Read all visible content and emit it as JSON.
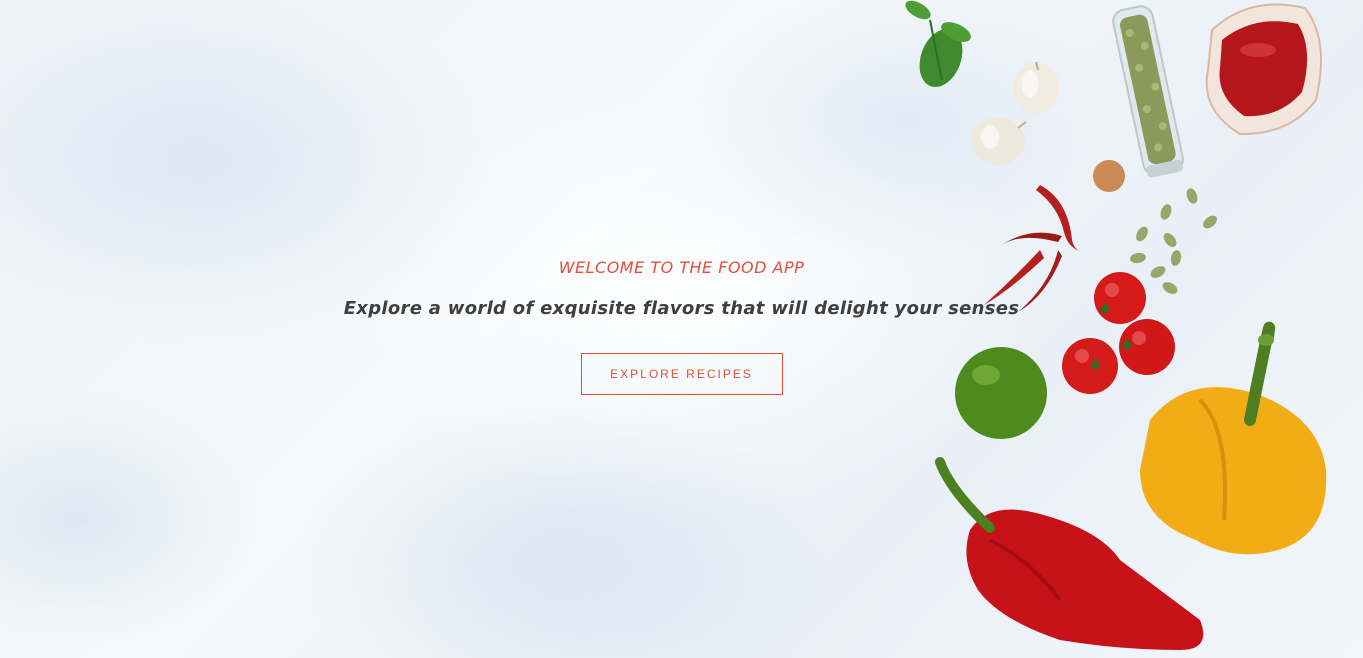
{
  "hero": {
    "welcome_text": "WELCOME TO THE FOOD APP",
    "tagline": "Explore a world of exquisite flavors that will delight your senses",
    "cta_label": "EXPLORE RECIPES"
  },
  "colors": {
    "accent": "#e0503a",
    "text_dark": "#3f3f3f",
    "background": "#eef3f8"
  },
  "decorations": {
    "icons": [
      "basil-icon",
      "garlic-icon",
      "seed-jar-icon",
      "ketchup-bowl-icon",
      "chili-icon",
      "pumpkin-seeds-icon",
      "tomato-icon",
      "lime-icon",
      "yellow-pepper-icon",
      "red-pepper-icon",
      "cracker-icon"
    ]
  }
}
